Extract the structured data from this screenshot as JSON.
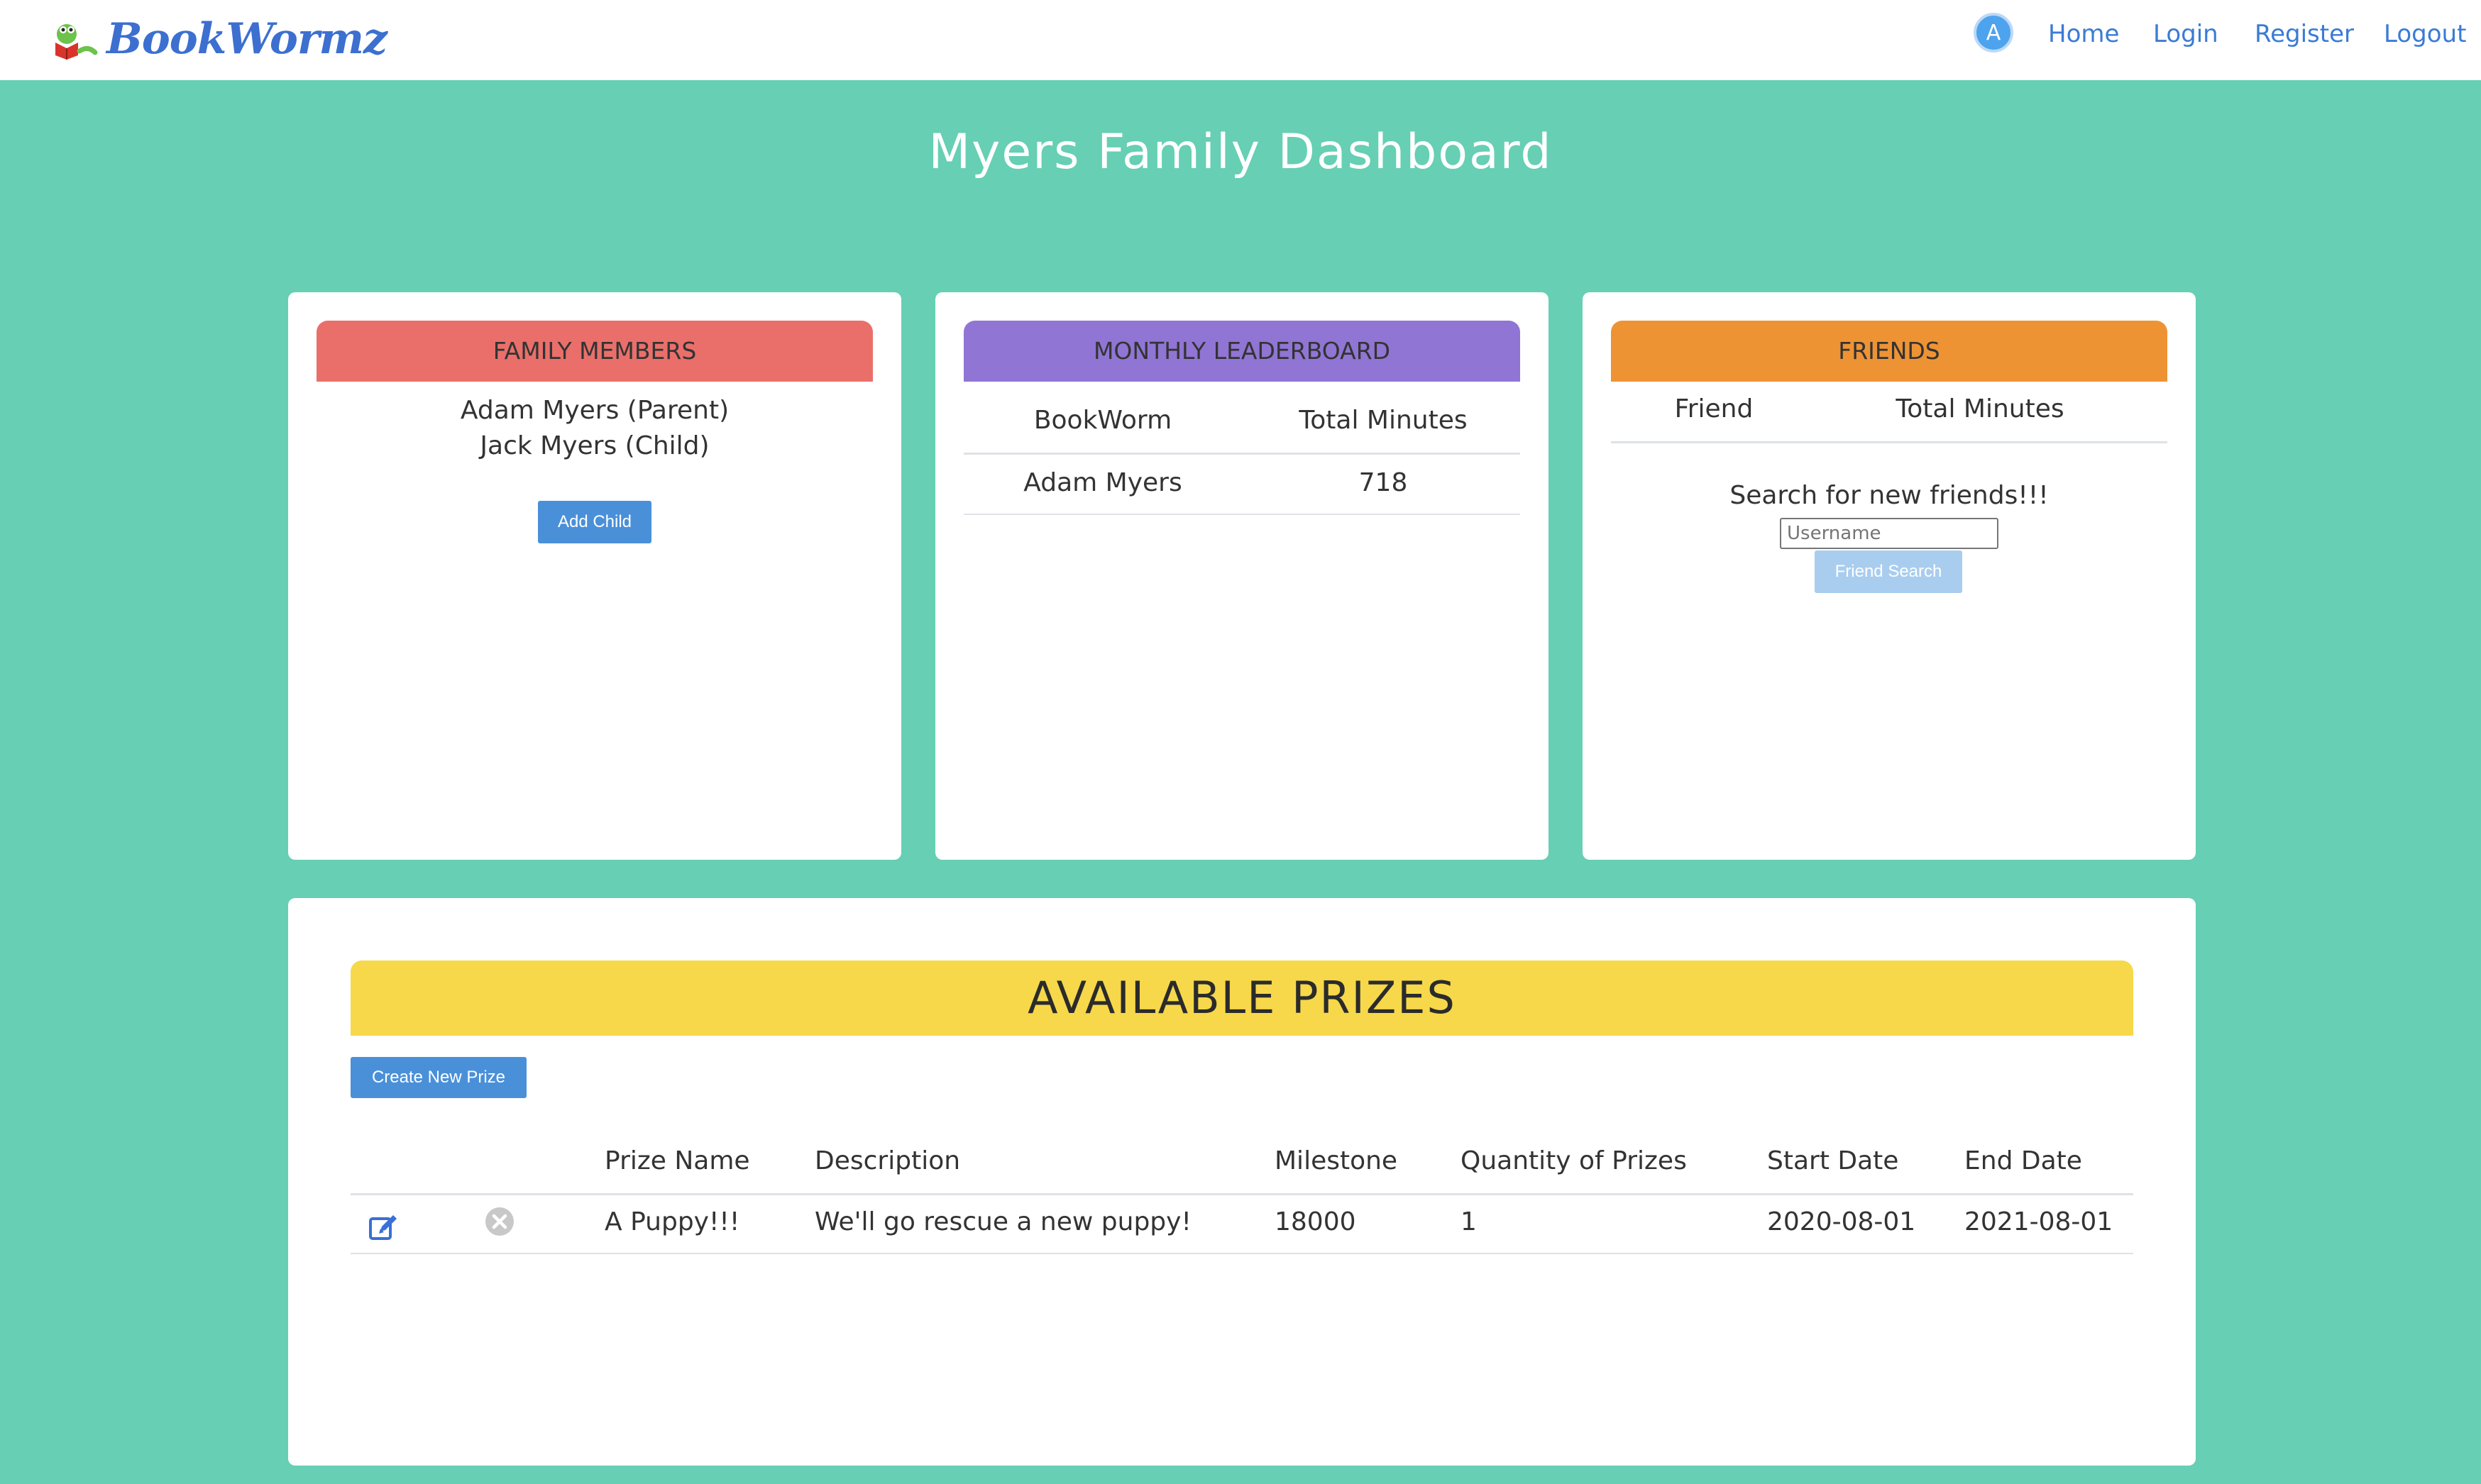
{
  "app": {
    "name": "BookWormz"
  },
  "nav": {
    "avatar_letter": "A",
    "links": [
      {
        "label": "Home"
      },
      {
        "label": "Login"
      },
      {
        "label": "Register"
      },
      {
        "label": "Logout"
      }
    ]
  },
  "page": {
    "title": "Myers Family Dashboard"
  },
  "family": {
    "header": "FAMILY MEMBERS",
    "header_color": "#ea6f6a",
    "members": [
      "Adam Myers (Parent)",
      "Jack Myers (Child)"
    ],
    "add_child_label": "Add Child"
  },
  "leaderboard": {
    "header": "MONTHLY LEADERBOARD",
    "header_color": "#9075d4",
    "columns": [
      "BookWorm",
      "Total Minutes"
    ],
    "rows": [
      {
        "name": "Adam Myers",
        "minutes": "718"
      }
    ]
  },
  "friends": {
    "header": "FRIENDS",
    "header_color": "#ee9334",
    "columns": [
      "Friend",
      "Total Minutes"
    ],
    "search_prompt": "Search for new friends!!!",
    "username_placeholder": "Username",
    "search_button_label": "Friend Search"
  },
  "prizes": {
    "header": "AVAILABLE PRIZES",
    "header_color": "#f6d84a",
    "create_button_label": "Create New Prize",
    "columns": [
      "Prize Name",
      "Description",
      "Milestone",
      "Quantity of Prizes",
      "Start Date",
      "End Date"
    ],
    "rows": [
      {
        "name": "A Puppy!!!",
        "description": "We'll go rescue a new puppy!",
        "milestone": "18000",
        "quantity": "1",
        "start_date": "2020-08-01",
        "end_date": "2021-08-01"
      }
    ]
  },
  "colors": {
    "background": "#66cfb4",
    "primary_button": "#4a90d9",
    "link": "#3a7bd5"
  },
  "icons": {
    "edit": "edit-icon",
    "delete": "close-circle-icon",
    "logo": "bookworm-logo-icon"
  }
}
